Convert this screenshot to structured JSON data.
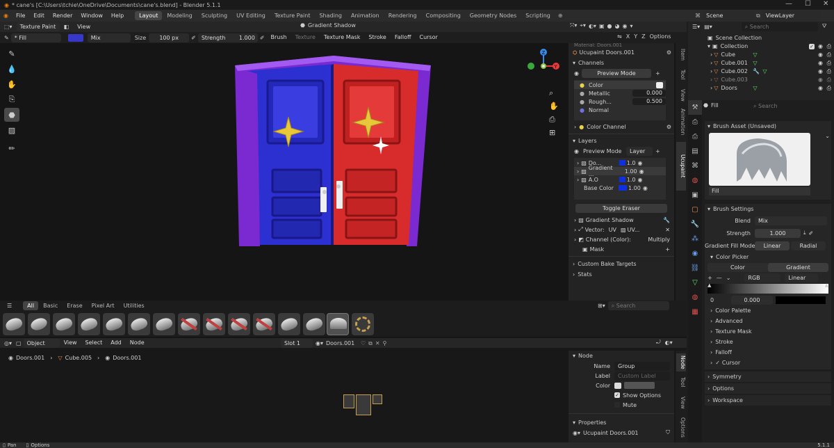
{
  "title": "* cane's [C:\\Users\\tchie\\OneDrive\\Documents\\cane's.blend] - Blender 5.1.1",
  "menu": [
    "File",
    "Edit",
    "Render",
    "Window",
    "Help"
  ],
  "workspaces": [
    "Layout",
    "Modeling",
    "Sculpting",
    "UV Editing",
    "Texture Paint",
    "Shading",
    "Animation",
    "Rendering",
    "Compositing",
    "Geometry Nodes",
    "Scripting"
  ],
  "scene": {
    "label": "Scene",
    "view_layer": "ViewLayer",
    "search_placeholder": "Search"
  },
  "viewport_header": {
    "mode": "Texture Paint",
    "view": "View",
    "brush": "Gradient Shadow",
    "tool_name": "* Fill",
    "blend": "Mix",
    "size_label": "Size",
    "size_value": "100 px",
    "strength_label": "Strength",
    "strength_value": "1.000",
    "menus": [
      "Brush",
      "Texture",
      "Texture Mask",
      "Stroke",
      "Falloff",
      "Cursor"
    ],
    "axes": [
      "X",
      "Y",
      "Z"
    ],
    "options": "Options",
    "accent_color": "#3838c8"
  },
  "ucupaint": {
    "material_partial": "Material: Doors.001",
    "title": "Ucupaint Doors.001",
    "channels_label": "Channels",
    "preview_mode": "Preview Mode",
    "channels": [
      {
        "name": "Color",
        "value": "",
        "dot": "#e8d44a"
      },
      {
        "name": "Metallic",
        "value": "0.000",
        "dot": "#aaaaaa"
      },
      {
        "name": "Rough...",
        "value": "0.500",
        "dot": "#aaaaaa"
      },
      {
        "name": "Normal",
        "value": "",
        "dot": "#7070e0"
      }
    ],
    "color_channel": "Color Channel",
    "layers_label": "Layers",
    "layer_dd": "Layer",
    "layers": [
      {
        "name": "Do...",
        "value": "1.0",
        "swatch": "#1030e0"
      },
      {
        "name": "Gradient ...",
        "value": "1.00",
        "swatch": ""
      },
      {
        "name": "A.O",
        "value": "1.0",
        "swatch": "#1030e0"
      },
      {
        "name": "Base Color",
        "value": "1.00",
        "swatch": "#1030e0"
      }
    ],
    "toggle_eraser": "Toggle Eraser",
    "gradient_shadow": "Gradient Shadow",
    "vector_label": "Vector:",
    "vector_uv": "UV",
    "vector_uv2": "UV...",
    "channel_color_label": "Channel (Color):",
    "channel_color_value": "Multiply",
    "mask": "Mask",
    "custom_bake": "Custom Bake Targets",
    "stats": "Stats",
    "side_tabs": [
      "Item",
      "Tool",
      "View",
      "Animation",
      "Ucupaint"
    ]
  },
  "asset_shelf": {
    "tabs": [
      "All",
      "Basic",
      "Erase",
      "Pixel Art",
      "Utilities"
    ],
    "search_placeholder": "Search"
  },
  "node_editor": {
    "header": {
      "object": "Object",
      "menus": [
        "View",
        "Select",
        "Add",
        "Node"
      ],
      "slot": "Slot 1",
      "material": "Doors.001"
    },
    "breadcrumb": [
      "Doors.001",
      "Cube.005",
      "Doors.001"
    ],
    "node_panel": {
      "title": "Node",
      "name_label": "Name",
      "name_value": "Group",
      "label_label": "Label",
      "label_placeholder": "Custom Label",
      "color_label": "Color",
      "show_options": "Show Options",
      "mute": "Mute",
      "properties": "Properties",
      "prop_value": "Ucupaint Doors.001"
    },
    "side_tabs": [
      "Node",
      "Tool",
      "View",
      "Options"
    ]
  },
  "outliner": {
    "scene_collection": "Scene Collection",
    "collection": "Collection",
    "items": [
      {
        "name": "Cube",
        "color": "#e89050"
      },
      {
        "name": "Cube.001",
        "color": "#e89050"
      },
      {
        "name": "Cube.002",
        "color": "#e89050"
      },
      {
        "name": "Cube.003",
        "color": "#8a6a50"
      },
      {
        "name": "Doors",
        "color": "#e89050"
      }
    ]
  },
  "properties": {
    "tool_name": "Fill",
    "search_placeholder": "Search",
    "brush_asset": "Brush Asset (Unsaved)",
    "brush_preview_label": "Fill",
    "brush_settings": "Brush Settings",
    "blend_label": "Blend",
    "blend_value": "Mix",
    "strength_label": "Strength",
    "strength_value": "1.000",
    "gradient_fill_mode_label": "Gradient Fill Mode",
    "gradient_mode_linear": "Linear",
    "gradient_mode_radial": "Radial",
    "color_picker": "Color Picker",
    "tab_color": "Color",
    "tab_gradient": "Gradient",
    "rgb": "RGB",
    "interp": "Linear",
    "stop_index": "0",
    "stop_pos": "0.000",
    "sections": [
      "Color Palette",
      "Advanced",
      "Texture Mask",
      "Stroke",
      "Falloff",
      "Cursor"
    ],
    "bottom_sections": [
      "Symmetry",
      "Options",
      "Workspace"
    ]
  },
  "statusbar": {
    "left": "Pan",
    "middle": "Options",
    "version": "5.1.1"
  }
}
